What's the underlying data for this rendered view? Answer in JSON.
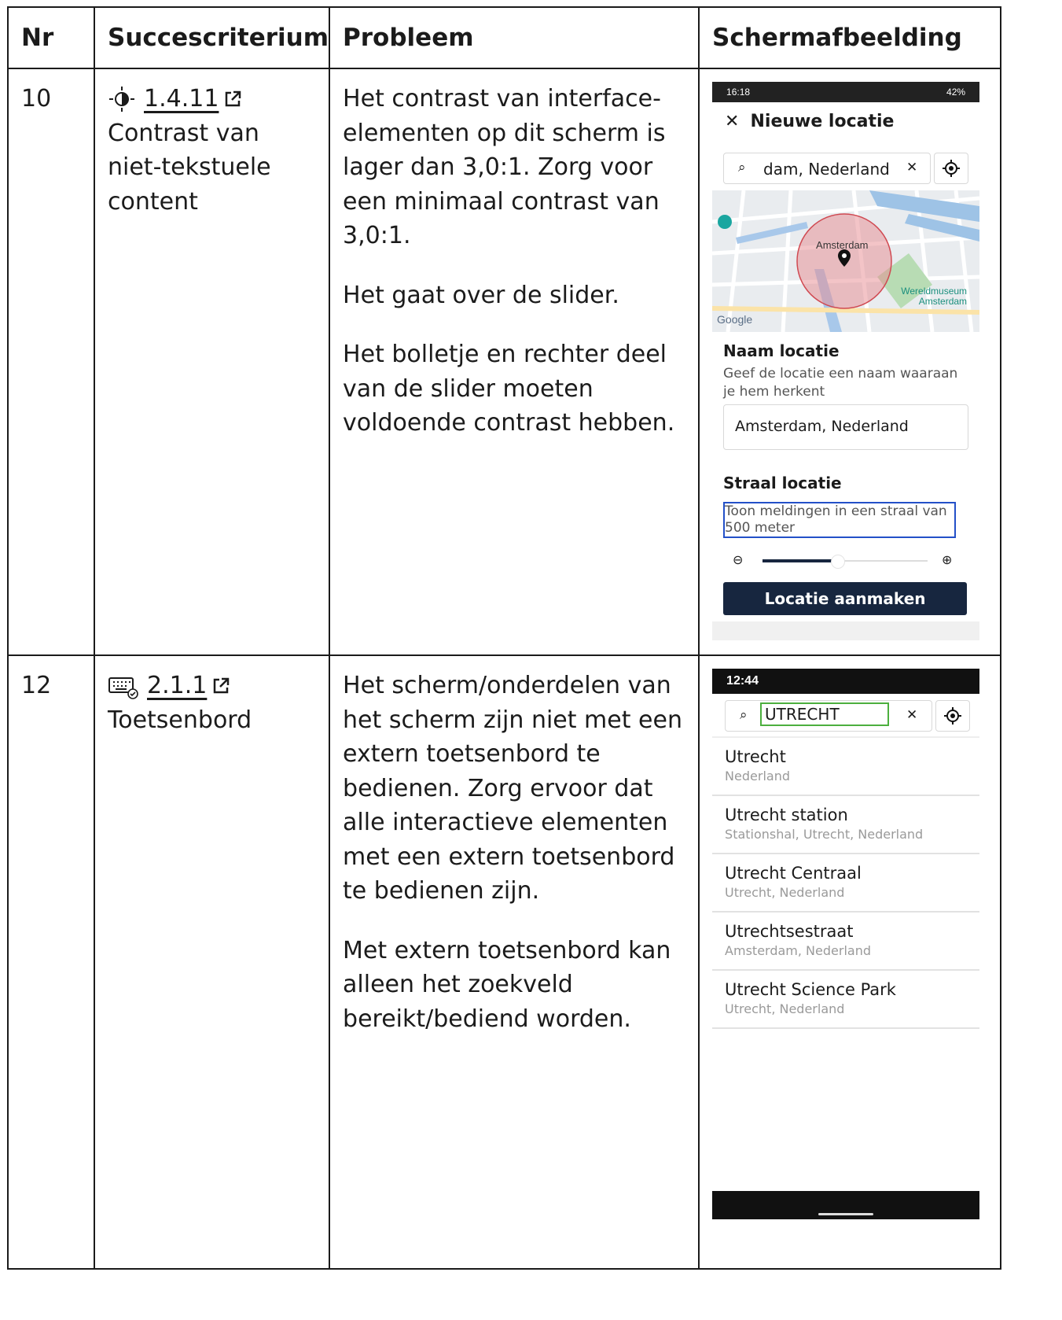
{
  "table": {
    "headers": [
      "Nr",
      "Succescriterium",
      "Probleem",
      "Schermafbeelding"
    ],
    "rows": [
      {
        "nr": "10",
        "criterion_code": "1.4.11",
        "criterion_name": "Contrast van niet-tekstuele content",
        "criterion_icon": "contrast-icon",
        "problem": [
          "Het contrast van interface-elementen op dit scherm is lager dan 3,0:1. Zorg voor een minimaal contrast van 3,0:1.",
          "Het gaat over de slider.",
          "Het bolletje en rechter deel van de slider moeten voldoende contrast hebben."
        ]
      },
      {
        "nr": "12",
        "criterion_code": "2.1.1",
        "criterion_name": "Toetsenbord",
        "criterion_icon": "keyboard-icon",
        "problem": [
          "Het scherm/onderdelen van het scherm zijn niet met een extern toetsenbord te bedienen. Zorg ervoor dat alle interactieve elementen met een extern toetsenbord te bedienen zijn.",
          "Met extern toetsenbord kan alleen het zoekveld bereikt/bediend worden."
        ]
      }
    ]
  },
  "shot1": {
    "status_time": "16:18",
    "status_battery": "42%",
    "title": "Nieuwe locatie",
    "search_value": "dam, Nederland",
    "map_label_city": "Amsterdam",
    "map_label_museum": "Wereldmuseum Amsterdam",
    "map_logo": "Google",
    "name_heading": "Naam locatie",
    "name_hint": "Geef de locatie een naam waaraan je hem herkent",
    "name_value": "Amsterdam, Nederland",
    "radius_heading": "Straal locatie",
    "radius_hint": "Toon meldingen in een straal van 500 meter",
    "slider_value": 0.45,
    "button_label": "Locatie aanmaken",
    "accent": "#17263f",
    "focus_color": "#2350c8"
  },
  "shot2": {
    "status_time": "12:44",
    "search_value": "UTRECHT",
    "focus_color": "#4caf3e",
    "results": [
      {
        "title": "Utrecht",
        "subtitle": "Nederland"
      },
      {
        "title": "Utrecht station",
        "subtitle": "Stationshal, Utrecht, Nederland"
      },
      {
        "title": "Utrecht Centraal",
        "subtitle": "Utrecht, Nederland"
      },
      {
        "title": "Utrechtsestraat",
        "subtitle": "Amsterdam, Nederland"
      },
      {
        "title": "Utrecht Science Park",
        "subtitle": "Utrecht, Nederland"
      }
    ]
  }
}
